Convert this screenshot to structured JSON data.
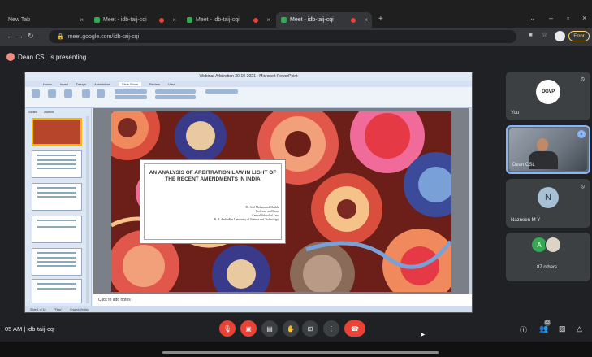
{
  "browser": {
    "tabs": [
      {
        "title": "New Tab",
        "active": false
      },
      {
        "title": "Meet - idb-taij-cqi",
        "active": false,
        "recording": true
      },
      {
        "title": "Meet - idb-taij-cqi",
        "active": false,
        "recording": true
      },
      {
        "title": "Meet - idb-taij-cqi",
        "active": true,
        "recording": true
      }
    ],
    "url": "meet.google.com/idb-taij-cqi",
    "error_label": "Error"
  },
  "meet": {
    "presenting_text": "Dean CSL is presenting",
    "meeting_code": "idb-taij-cqi",
    "clock": "05 AM",
    "participant_count_badge": "83",
    "participants": [
      {
        "name": "You",
        "logo_text": "DGVP"
      },
      {
        "name": "Dean CSL"
      },
      {
        "name": "Nazneen M Y",
        "initial": "N"
      },
      {
        "name": "87 others",
        "initial": "A"
      }
    ]
  },
  "powerpoint": {
    "window_title": "Webinar Arbitration 30-10-2021 - Microsoft PowerPoint",
    "ribbon_tabs": [
      "Home",
      "Insert",
      "Design",
      "Animations",
      "Slide Show",
      "Review",
      "View"
    ],
    "selected_tab": "Slide Show",
    "pane_tabs": [
      "Slides",
      "Outline"
    ],
    "notes_placeholder": "Click to add notes",
    "status": [
      "Slide 1 of 10",
      "\"Flow\"",
      "English (India)"
    ],
    "slide": {
      "title": "AN ANALYSIS OF ARBITRATION LAW IN LIGHT OF THE RECENT AMENDMENTS IN INDIA",
      "author_lines": [
        "Dr. Asif Mohammed Shaikh",
        "Professor and Dean",
        "Central School of Law",
        "B. R. Ambedkar University of Science and Technology"
      ]
    }
  },
  "colors": {
    "background": "#202124",
    "tile": "#3c4043",
    "accent_red": "#ea4335",
    "speaking_blue": "#8ab4f8"
  }
}
